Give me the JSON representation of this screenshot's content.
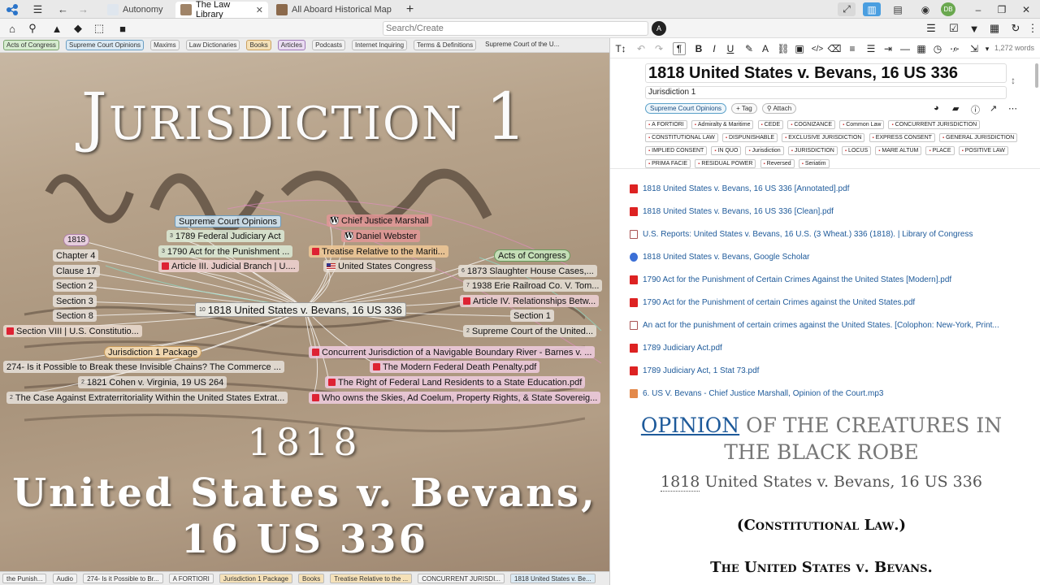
{
  "tabs": [
    {
      "label": "Autonomy"
    },
    {
      "label": "The Law Library"
    },
    {
      "label": "All Aboard Historical Map"
    }
  ],
  "toolbar": {
    "search_placeholder": "Search/Create"
  },
  "user_initials": "DB",
  "bookmarks": [
    "Acts of Congress",
    "Supreme Court Opinions",
    "Maxims",
    "Law Dictionaries",
    "Books",
    "Articles",
    "Podcasts",
    "Internet Inquiring",
    "Terms & Definitions",
    "Supreme Court of the U..."
  ],
  "hero": {
    "title": "Jurisdiction 1",
    "year": "1818",
    "case_line1": "United States v. Bevans,",
    "case_line2": "16 US 336"
  },
  "graph_nodes": {
    "n1": "Supreme Court Opinions",
    "n2": "1789 Federal Judiciary Act",
    "n3": "1790 Act for the Punishment ...",
    "n4": "Article III. Judicial Branch | U....",
    "n5": "Chief Justice Marshall",
    "n6": "Daniel Webster",
    "n7": "Treatise Relative to the Mariti...",
    "n8": "United States Congress",
    "n9": "1818",
    "n10": "Chapter 4",
    "n11": "Clause 17",
    "n12": "Section 2",
    "n13": "Section 3",
    "n14": "Section 8",
    "n15": "Section VIII | U.S. Constitutio...",
    "n16": "Acts of Congress",
    "n17": "1873 Slaughter House Cases,...",
    "n18": "1938 Erie Railroad Co. V. Tom...",
    "n19": "Article IV. Relationships Betw...",
    "n20": "Section 1",
    "n21": "Supreme Court of the United...",
    "n22": "1818 United States v. Bevans, 16 US 336",
    "n23": "Jurisdiction 1 Package",
    "n24": "274- Is it Possible to Break these Invisible Chains? The Commerce ...",
    "n25": "1821 Cohen v. Virginia, 19 US 264",
    "n26": "The Case Against Extraterritoriality Within the United States Extrat...",
    "n27": "Concurrent Jurisdiction of a Navigable Boundary River - Barnes v. ...",
    "n28": "The Modern Federal Death Penalty.pdf",
    "n29": "The Right of Federal Land Residents to a State Education.pdf",
    "n30": "Who owns the Skies, Ad Coelum, Property Rights, & State Sovereig..."
  },
  "node_badges": {
    "n2": "3",
    "n3": "3",
    "n17": "6",
    "n18": "7",
    "n21": "2",
    "n22": "10",
    "n25": "2",
    "n26": "2"
  },
  "bottom_tabs": [
    "the Punish...",
    "Audio",
    "274- Is it Possible to Br...",
    "A FORTIORI",
    "Jurisdiction 1 Package",
    "Books",
    "Treatise Relative to the ...",
    "CONCURRENT JURISDI...",
    "1818 United States v. Be..."
  ],
  "editor": {
    "word_count": "1,272 words",
    "title": "1818 United States v. Bevans, 16 US 336",
    "subtitle": "Jurisdiction 1",
    "tag_chip": "Supreme Court Opinions",
    "tag_button": "Tag",
    "attach_button": "Attach",
    "keywords": [
      "A FORTIORI",
      "Admiralty & Maritime",
      "CEDE",
      "COGNIZANCE",
      "Common Law",
      "CONCURRENT JURISDICTION",
      "CONSTITUTIONAL LAW",
      "DISPUNISHABLE",
      "EXCLUSIVE JURISDICTION",
      "EXPRESS CONSENT",
      "GENERAL JURISDICTION",
      "IMPLIED CONSENT",
      "IN QUO",
      "Jurisdiction",
      "JURISDICTION",
      "LOCUS",
      "MARE ALTUM",
      "PLACE",
      "POSITIVE LAW",
      "PRIMA FACIE",
      "RESIDUAL POWER",
      "Reversed",
      "Seriatim"
    ],
    "attachments": [
      {
        "label": "1818 United States v. Bevans, 16 US 336 [Annotated].pdf",
        "icon": "pdf"
      },
      {
        "label": "1818 United States v. Bevans, 16 US 336 [Clean].pdf",
        "icon": "pdf"
      },
      {
        "label": "U.S. Reports: United States v. Bevans, 16 U.S. (3 Wheat.) 336 (1818). | Library of Congress",
        "icon": "loc"
      },
      {
        "label": "1818 United States v. Bevans, Google Scholar",
        "icon": "gs"
      },
      {
        "label": "1790 Act for the Punishment of Certain Crimes Against the United States [Modern].pdf",
        "icon": "pdf"
      },
      {
        "label": "1790 Act for the Punishment of certain Crimes against the United States.pdf",
        "icon": "pdf"
      },
      {
        "label": "An act for the punishment of certain crimes against the United States. [Colophon: New-York, Print...",
        "icon": "loc"
      },
      {
        "label": "1789 Judiciary Act.pdf",
        "icon": "pdf"
      },
      {
        "label": "1789 Judiciary Act, 1 Stat 73.pdf",
        "icon": "pdf"
      },
      {
        "label": "6. US V. Bevans - Chief Justice Marshall, Opinion of the Court.mp3",
        "icon": "mp3"
      }
    ],
    "doc": {
      "heading_lead": "OPINION",
      "heading_rest1": " OF THE CREATURES IN",
      "heading_rest2": "THE BLACK ROBE",
      "case_year": "1818",
      "case_rest": " United States v. Bevans, 16 US 336",
      "constitutional": "(Constitutional Law.)",
      "tusb": "The United States v. Bevans."
    }
  }
}
